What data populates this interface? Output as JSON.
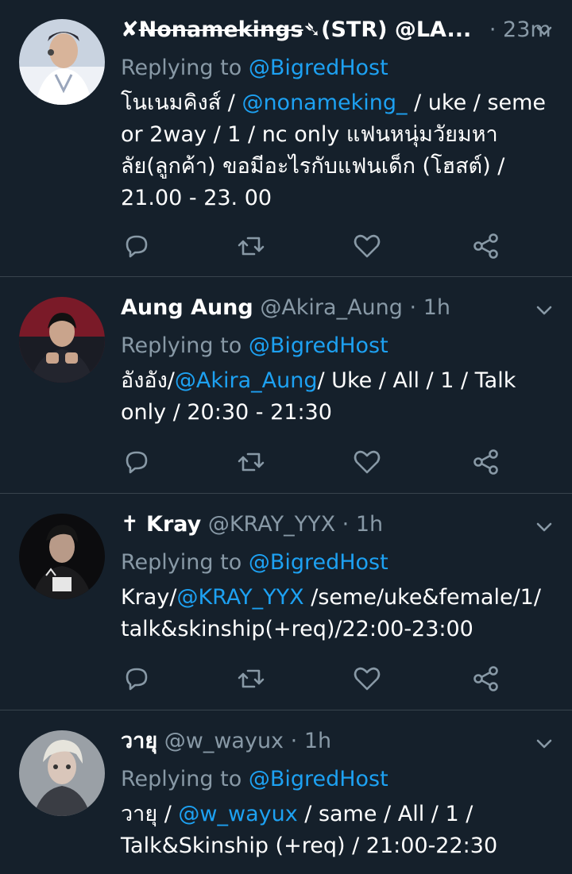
{
  "tweets": [
    {
      "name_prefix": "✘",
      "name_strike": "Nonamekings",
      "name_suffix": "➴(STR) @LA...",
      "handle": "",
      "separator": "·",
      "time": "23m",
      "replying_label": "Replying to",
      "replying_to": "@BigredHost",
      "body_lines": [
        {
          "pre": "โนเนมคิงส์ / ",
          "link": "@nonameking_",
          "post": "  / uke / seme"
        },
        {
          "pre": "or 2way / 1 / nc only แฟนหนุ่มวัยมหา",
          "link": "",
          "post": ""
        },
        {
          "pre": "ลัย(ลูกค้า) ขอมีอะไรกับแฟนเด็ก (โฮสต์) /",
          "link": "",
          "post": ""
        },
        {
          "pre": "21.00 - 23. 00",
          "link": "",
          "post": ""
        }
      ]
    },
    {
      "name_prefix": "",
      "name_strike": "",
      "name_suffix": "Aung Aung",
      "handle": "@Akira_Aung",
      "separator": "·",
      "time": "1h",
      "replying_label": "Replying to",
      "replying_to": "@BigredHost",
      "body_lines": [
        {
          "pre": "อังอัง/",
          "link": "@Akira_Aung",
          "post": "/ Uke / All / 1 / Talk"
        },
        {
          "pre": "only / 20:30 - 21:30",
          "link": "",
          "post": ""
        }
      ]
    },
    {
      "name_prefix": "",
      "name_strike": "",
      "name_suffix": "✝ Kray",
      "handle": "@KRAY_YYX",
      "separator": "·",
      "time": "1h",
      "replying_label": "Replying to",
      "replying_to": "@BigredHost",
      "body_lines": [
        {
          "pre": "Kray/",
          "link": "@KRAY_YYX",
          "post": " /seme/uke&female/1/"
        },
        {
          "pre": "talk&skinship(+req)/22:00-23:00",
          "link": "",
          "post": ""
        }
      ]
    },
    {
      "name_prefix": "",
      "name_strike": "",
      "name_suffix": "วายุ",
      "handle": "@w_wayux",
      "separator": "·",
      "time": "1h",
      "replying_label": "Replying to",
      "replying_to": "@BigredHost",
      "body_lines": [
        {
          "pre": "วายุ / ",
          "link": "@w_wayux",
          "post": " / same / All / 1 /"
        },
        {
          "pre": "Talk&Skinship (+req) / 21:00-22:30",
          "link": "",
          "post": ""
        }
      ]
    }
  ],
  "icons": {
    "reply": "reply-icon",
    "retweet": "retweet-icon",
    "like": "like-icon",
    "share": "share-icon",
    "more": "chevron-down-icon"
  },
  "colors": {
    "background": "#15202b",
    "link": "#1da1f2",
    "secondary_text": "#8899a6",
    "divider": "#38444d"
  }
}
